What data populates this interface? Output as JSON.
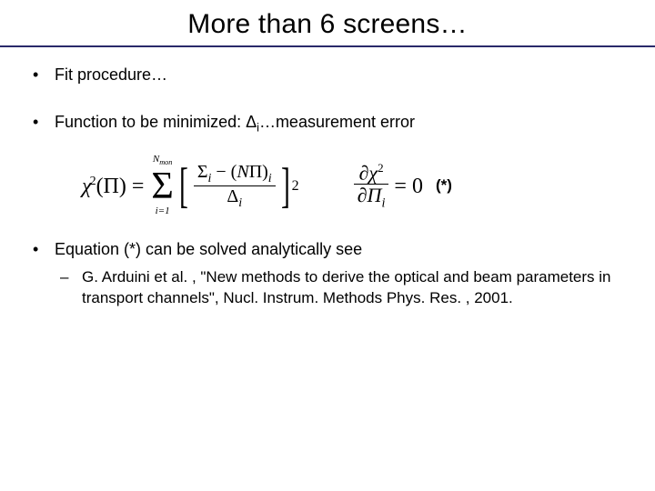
{
  "title": "More than 6 screens…",
  "bullets": {
    "b1": "Fit procedure…",
    "b2_pre": "Function to be minimized: ",
    "b2_delta": "Δ",
    "b2_sub": "i",
    "b2_post": "…measurement error",
    "b3": "Equation (*) can be solved analytically see",
    "ref": "G. Arduini et al. , \"New methods to derive the optical and beam parameters in transport channels\", Nucl. Instrum. Methods Phys. Res. , 2001."
  },
  "eq1": {
    "lhs_chi": "χ",
    "lhs_sq": "2",
    "lhs_arg": "(Π) =",
    "sig_top": "N",
    "sig_top_sub": "mon",
    "sig_bot": "i=1",
    "num_sigma": "Σ",
    "num_sub": "i",
    "num_mid": " − (",
    "num_N": "N",
    "num_pi": "Π)",
    "num_sub2": "i",
    "den_delta": "Δ",
    "den_sub": "i",
    "outer_sq": "2"
  },
  "eq2": {
    "d1": "∂",
    "chi": "χ",
    "sq": "2",
    "d2": "∂Π",
    "sub": "i",
    "eq0": "= 0",
    "star": "(*)"
  }
}
